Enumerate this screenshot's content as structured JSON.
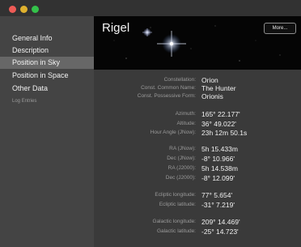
{
  "window": {
    "title": ""
  },
  "sidebar": {
    "items": [
      {
        "label": "General Info"
      },
      {
        "label": "Description"
      },
      {
        "label": "Position in Sky"
      },
      {
        "label": "Position in Space"
      },
      {
        "label": "Other Data"
      },
      {
        "label": "Log Entries"
      }
    ],
    "selected_index": 2
  },
  "header": {
    "title": "Rigel",
    "more_button": "More..."
  },
  "details": {
    "constellation": {
      "label": "Constellation:",
      "value": "Orion"
    },
    "const_common": {
      "label": "Const. Common Name:",
      "value": "The Hunter"
    },
    "const_possessive": {
      "label": "Const. Possessive Form:",
      "value": "Orionis"
    },
    "azimuth": {
      "label": "Azimuth:",
      "value": "165° 22.177'"
    },
    "altitude": {
      "label": "Altitude:",
      "value": "36° 49.022'"
    },
    "hour_angle": {
      "label": "Hour Angle (JNow):",
      "value": "23h 12m 50.1s"
    },
    "ra_jnow": {
      "label": "RA (JNow):",
      "value": "5h 15.433m"
    },
    "dec_jnow": {
      "label": "Dec (JNow):",
      "value": "-8° 10.966'"
    },
    "ra_j2000": {
      "label": "RA (J2000):",
      "value": "5h 14.538m"
    },
    "dec_j2000": {
      "label": "Dec (J2000):",
      "value": "-8° 12.099'"
    },
    "ecl_lon": {
      "label": "Ecliptic longitude:",
      "value": "77° 5.654'"
    },
    "ecl_lat": {
      "label": "Ecliptic latitude:",
      "value": "-31° 7.219'"
    },
    "gal_lon": {
      "label": "Galactic longitude:",
      "value": "209° 14.469'"
    },
    "gal_lat": {
      "label": "Galactic latitude:",
      "value": "-25° 14.723'"
    }
  },
  "colors": {
    "sidebar_bg": "#444444",
    "selected_bg": "#676767",
    "content_bg": "#3a3a3a",
    "header_bg": "#050505"
  }
}
